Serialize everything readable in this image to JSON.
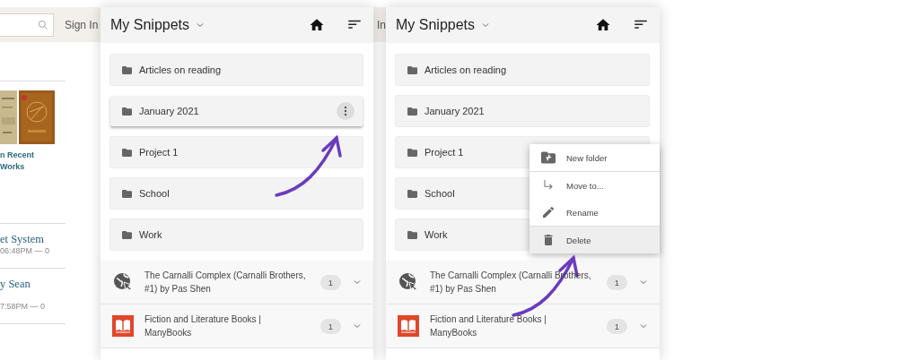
{
  "background_page": {
    "sign_in": "Sign In",
    "card_title_lines": [
      "n Recent",
      "Works"
    ],
    "posts": [
      {
        "title": "et System",
        "meta": "06:48PM — 0"
      },
      {
        "title": "y Sean",
        "meta": "7:58PM — 0"
      }
    ],
    "strip_text": "In"
  },
  "panels": [
    {
      "title": "My Snippets",
      "annotations": [
        {
          "kind": "arrow"
        }
      ],
      "folders": [
        {
          "name": "Articles on reading",
          "selected": false
        },
        {
          "name": "January 2021",
          "selected": true
        },
        {
          "name": "Project 1",
          "selected": false
        },
        {
          "name": "School",
          "selected": false
        },
        {
          "name": "Work",
          "selected": false
        }
      ],
      "groups": [
        {
          "kind": "site",
          "title": "The Carnalli Complex (Carnalli Brothers, #1) by Pas Shen",
          "count": "1"
        },
        {
          "kind": "book",
          "title": "Fiction and Literature Books | ManyBooks",
          "count": "1"
        }
      ]
    },
    {
      "title": "My Snippets",
      "annotations": [
        {
          "kind": "arrow"
        }
      ],
      "folders": [
        {
          "name": "Articles on reading",
          "selected": false
        },
        {
          "name": "January 2021",
          "selected": false
        },
        {
          "name": "Project 1",
          "selected": false
        },
        {
          "name": "School",
          "selected": false
        },
        {
          "name": "Work",
          "selected": false
        }
      ],
      "menu": [
        {
          "kind": "new-folder",
          "label": "New folder",
          "selected": false
        },
        {
          "kind": "move",
          "label": "Move to...",
          "selected": false
        },
        {
          "kind": "rename",
          "label": "Rename",
          "selected": false
        },
        {
          "kind": "delete",
          "label": "Delete",
          "selected": true
        }
      ],
      "groups": [
        {
          "kind": "site",
          "title": "The Carnalli Complex (Carnalli Brothers, #1) by Pas Shen",
          "count": "1"
        },
        {
          "kind": "book",
          "title": "Fiction and Literature Books | ManyBooks",
          "count": "1"
        }
      ]
    }
  ]
}
